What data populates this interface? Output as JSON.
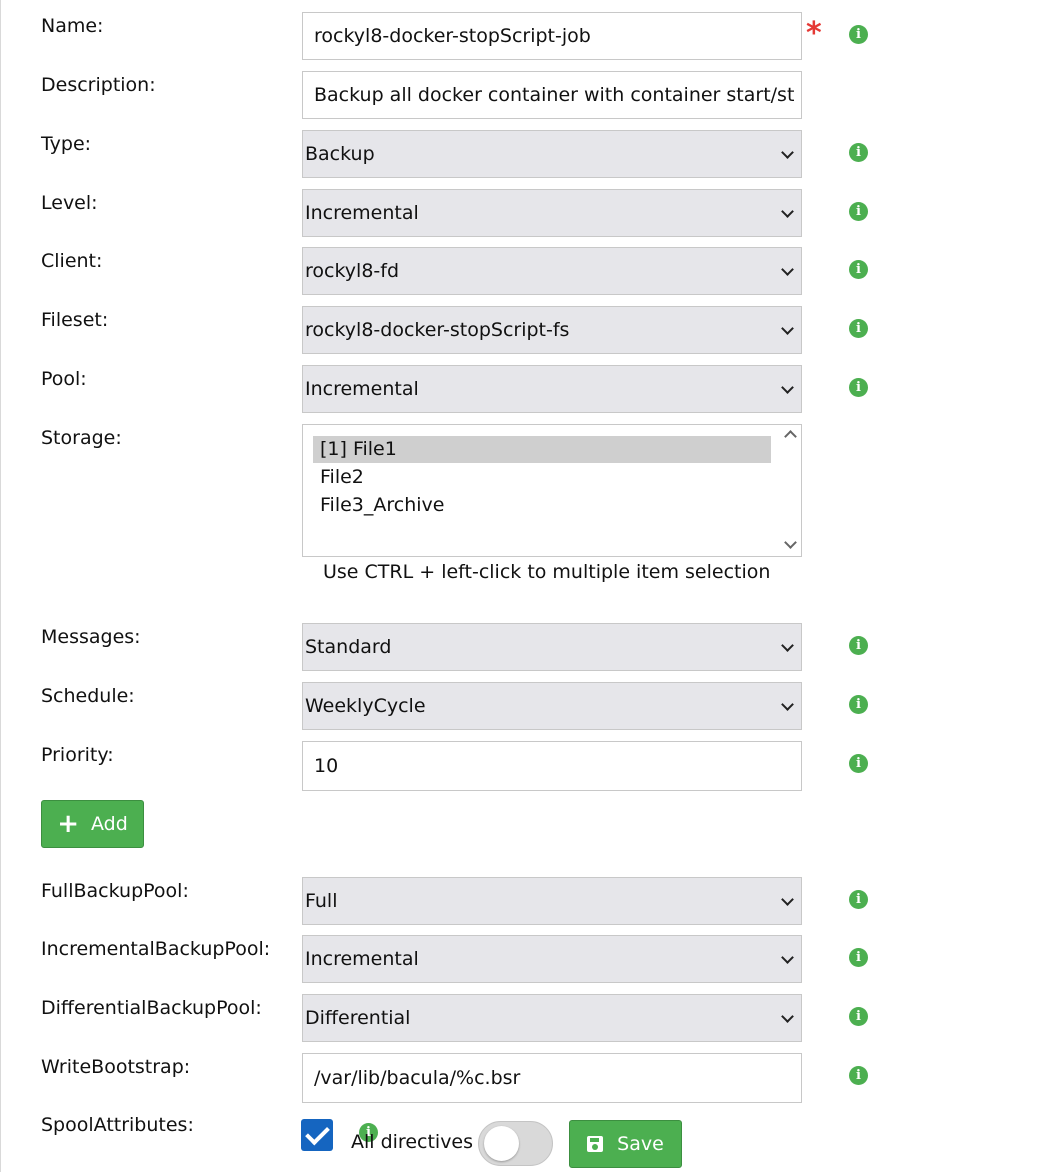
{
  "form": {
    "name": {
      "label": "Name:",
      "value": "rockyl8-docker-stopScript-job"
    },
    "description": {
      "label": "Description:",
      "value": "Backup all docker container with container start/st"
    },
    "type": {
      "label": "Type:",
      "value": "Backup"
    },
    "level": {
      "label": "Level:",
      "value": "Incremental"
    },
    "client": {
      "label": "Client:",
      "value": "rockyl8-fd"
    },
    "fileset": {
      "label": "Fileset:",
      "value": "rockyl8-docker-stopScript-fs"
    },
    "pool": {
      "label": "Pool:",
      "value": "Incremental"
    },
    "storage": {
      "label": "Storage:",
      "options": [
        "[1] File1",
        "File2",
        "File3_Archive"
      ],
      "selected": "[1] File1",
      "hint": "Use CTRL + left-click to multiple item selection"
    },
    "messages": {
      "label": "Messages:",
      "value": "Standard"
    },
    "schedule": {
      "label": "Schedule:",
      "value": "WeeklyCycle"
    },
    "priority": {
      "label": "Priority:",
      "value": "10"
    },
    "add_button": "Add",
    "full_backup_pool": {
      "label": "FullBackupPool:",
      "value": "Full"
    },
    "incremental_backup_pool": {
      "label": "IncrementalBackupPool:",
      "value": "Incremental"
    },
    "differential_backup_pool": {
      "label": "DifferentialBackupPool:",
      "value": "Differential"
    },
    "write_bootstrap": {
      "label": "WriteBootstrap:",
      "value": "/var/lib/bacula/%c.bsr"
    },
    "spool_attributes": {
      "label": "SpoolAttributes:",
      "checked": true
    },
    "all_directives": {
      "label": "All directives",
      "enabled": false
    },
    "save_button": "Save",
    "required_marker": "*",
    "info_glyph": "i"
  },
  "colors": {
    "accent_green": "#4caf50",
    "required_red": "#e53935",
    "checkbox_blue": "#1565c0",
    "select_bg": "#e6e6ea"
  },
  "icons": [
    "info-icon",
    "chevron-down-icon",
    "plus-icon",
    "save-icon",
    "checkmark-icon"
  ]
}
